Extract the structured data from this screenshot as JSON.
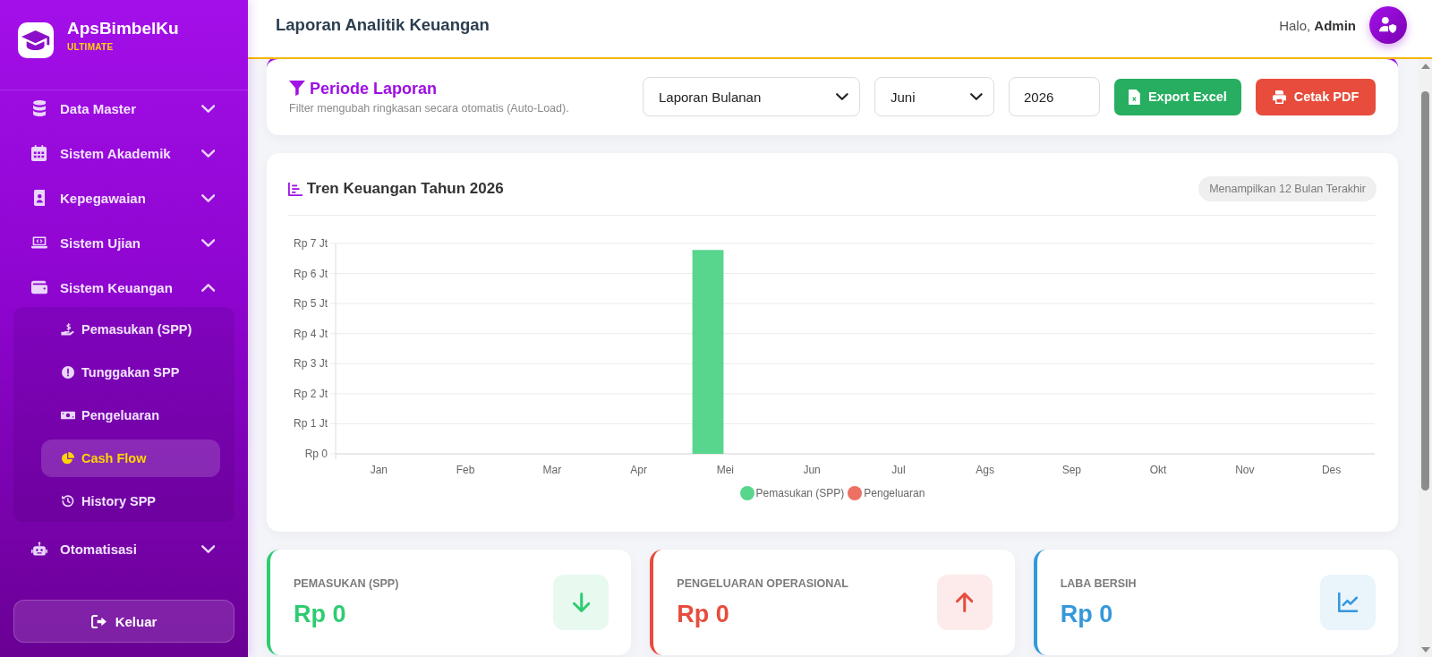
{
  "sidebar": {
    "brand": {
      "name": "ApsBimbelKu",
      "tagline": "ULTIMATE"
    },
    "menu": [
      {
        "label": "Data Master",
        "expanded": false
      },
      {
        "label": "Sistem Akademik",
        "expanded": false
      },
      {
        "label": "Kepegawaian",
        "expanded": false
      },
      {
        "label": "Sistem Ujian",
        "expanded": false
      },
      {
        "label": "Sistem Keuangan",
        "expanded": true,
        "children": [
          {
            "label": "Pemasukan (SPP)",
            "selected": false
          },
          {
            "label": "Tunggakan SPP",
            "selected": false
          },
          {
            "label": "Pengeluaran",
            "selected": false
          },
          {
            "label": "Cash Flow",
            "selected": true
          },
          {
            "label": "History SPP",
            "selected": false
          }
        ]
      },
      {
        "label": "Otomatisasi",
        "expanded": false
      }
    ],
    "logout": {
      "label": "Keluar"
    }
  },
  "header": {
    "title": "Laporan Analitik Keuangan",
    "greeting": "Halo, **Admin**"
  },
  "filter": {
    "title": "Periode Laporan",
    "subtitle": "Filter mengubah ringkasan secara otomatis (Auto-Load).",
    "report_type": {
      "value": "Laporan Bulanan"
    },
    "month": {
      "value": "Juni"
    },
    "year": {
      "value": "2026"
    },
    "buttons": [
      {
        "label": "Export Excel",
        "kind": "excel"
      },
      {
        "label": "Cetak PDF",
        "kind": "pdf"
      }
    ]
  },
  "chart": {
    "title": "Tren Keuangan Tahun 2026",
    "badge": "Menampilkan 12 Bulan Terakhir",
    "y_axis_labels": [
      "Rp 7 Jt",
      "Rp 6 Jt",
      "Rp 5 Jt",
      "Rp 4 Jt",
      "Rp 3 Jt",
      "Rp 2 Jt",
      "Rp 1 Jt",
      "Rp 0"
    ],
    "x_axis_labels": [
      "Jan",
      "Feb",
      "Mar",
      "Apr",
      "Mei",
      "Jun",
      "Jul",
      "Ags",
      "Sep",
      "Okt",
      "Nov",
      "Des"
    ],
    "legend": [
      {
        "name": "Pemasukan (SPP)",
        "color": "#58d68d"
      },
      {
        "name": "Pengeluaran",
        "color": "#ec7063"
      }
    ]
  },
  "stats": [
    {
      "label": "PEMASUKAN (SPP)",
      "value": "Rp 0",
      "color": "#2ecc71",
      "kind": "income"
    },
    {
      "label": "PENGELUARAN OPERASIONAL",
      "value": "Rp 0",
      "color": "#e74c3c",
      "kind": "expense"
    },
    {
      "label": "LABA BERSIH",
      "value": "Rp 0",
      "color": "#3498db",
      "kind": "profit"
    }
  ]
}
